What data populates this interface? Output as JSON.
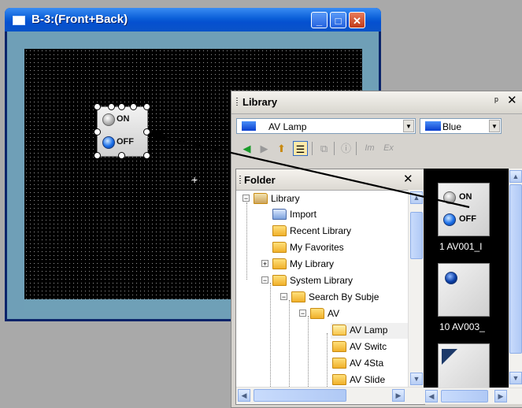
{
  "window": {
    "title": "B-3:(Front+Back)",
    "minimize_symbol": "_",
    "maximize_symbol": "□",
    "close_symbol": "✕"
  },
  "canvas": {
    "widget": {
      "on_label": "ON",
      "off_label": "OFF"
    },
    "crosshair_symbol": "+"
  },
  "library": {
    "title": "Library",
    "pin_symbol": "ᵖ",
    "close_symbol": "✕",
    "category_select": {
      "value": "AV Lamp"
    },
    "color_select": {
      "value": "Blue"
    },
    "toolbar": {
      "items": [
        {
          "name": "back",
          "glyph": "◀"
        },
        {
          "name": "forward",
          "glyph": "▶"
        },
        {
          "name": "up-folder",
          "glyph": "⬆"
        },
        {
          "name": "folder-tree",
          "glyph": "☰"
        },
        {
          "name": "copy",
          "glyph": "⧉"
        },
        {
          "name": "info",
          "glyph": "ⓘ"
        },
        {
          "name": "import",
          "glyph": "Im"
        },
        {
          "name": "export",
          "glyph": "Ex"
        }
      ]
    }
  },
  "folder": {
    "title": "Folder",
    "close_symbol": "✕",
    "tree": [
      {
        "label": "Library"
      },
      {
        "label": "Import"
      },
      {
        "label": "Recent Library"
      },
      {
        "label": "My Favorites"
      },
      {
        "label": "My Library"
      },
      {
        "label": "System Library"
      },
      {
        "label": "Search By Subje"
      },
      {
        "label": "AV"
      },
      {
        "label": "AV Lamp"
      },
      {
        "label": "AV Switc"
      },
      {
        "label": "AV 4Sta"
      },
      {
        "label": "AV Slide"
      }
    ]
  },
  "preview": {
    "items": [
      {
        "caption": "1 AV001_I",
        "on_label": "ON",
        "off_label": "OFF"
      },
      {
        "caption": "10 AV003_"
      },
      {
        "caption": ""
      }
    ]
  },
  "colors": {
    "titlebar_blue": "#0a5fd8",
    "canvas_bg": "#000000",
    "panel_bg": "#d6d3ce",
    "folder_yellow": "#f0b02a"
  }
}
